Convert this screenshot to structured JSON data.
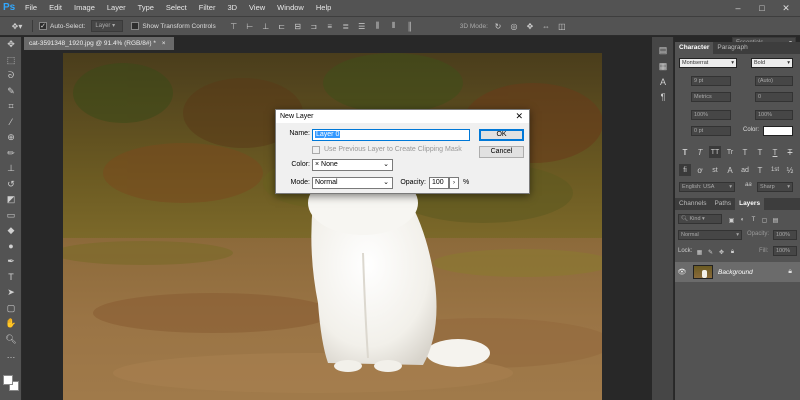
{
  "app": {
    "logo": "Ps"
  },
  "menu": [
    "File",
    "Edit",
    "Image",
    "Layer",
    "Type",
    "Select",
    "Filter",
    "3D",
    "View",
    "Window",
    "Help"
  ],
  "window_controls": {
    "minimize": "–",
    "maximize": "□",
    "close": "✕"
  },
  "options_bar": {
    "auto_select_label": "Auto-Select:",
    "auto_select_target": "Layer",
    "show_transform_label": "Show Transform Controls",
    "mode_3d_label": "3D Mode:",
    "workspace": "Essentials"
  },
  "document": {
    "tab_title": "cat-3591348_1920.jpg @ 91.4% (RGB/8#) *",
    "tab_close": "×"
  },
  "panels": {
    "top_tabs": [
      "Character",
      "Paragraph"
    ],
    "font_family": "Montserrat",
    "font_style": "Bold",
    "font_size": "9 pt",
    "leading": "(Auto)",
    "kerning": "Metrics",
    "tracking": "0",
    "vertical_scale": "100%",
    "horizontal_scale": "100%",
    "baseline_shift": "0 pt",
    "color_label": "Color:",
    "language": "English: USA",
    "antialias_icon": "aa",
    "antialias": "Sharp",
    "style_buttons": [
      "T",
      "T",
      "TT",
      "Tr",
      "T",
      "T",
      "T",
      "T"
    ],
    "glyph_buttons": [
      "fi",
      "ơ",
      "st",
      "A",
      "ad",
      "T",
      "1st",
      "½"
    ],
    "layer_tabs": [
      "Channels",
      "Paths",
      "Layers"
    ],
    "kind_filter": "Kind",
    "blend_mode": "Normal",
    "opacity_label": "Opacity:",
    "opacity": "100%",
    "lock_label": "Lock:",
    "fill_label": "Fill:",
    "fill": "100%",
    "layer_name": "Background"
  },
  "dialog": {
    "title": "New Layer",
    "close": "✕",
    "name_label": "Name:",
    "name_value": "Layer 0",
    "clipping_label": "Use Previous Layer to Create Clipping Mask",
    "color_label": "Color:",
    "color_value": "× None",
    "mode_label": "Mode:",
    "mode_value": "Normal",
    "opacity_label": "Opacity:",
    "opacity_value": "100",
    "opacity_unit": "%",
    "ok": "OK",
    "cancel": "Cancel"
  },
  "colors": {
    "ui_bg": "#535353",
    "dark_bg": "#282828",
    "accent": "#31a8ff",
    "selection": "#3399ff"
  }
}
